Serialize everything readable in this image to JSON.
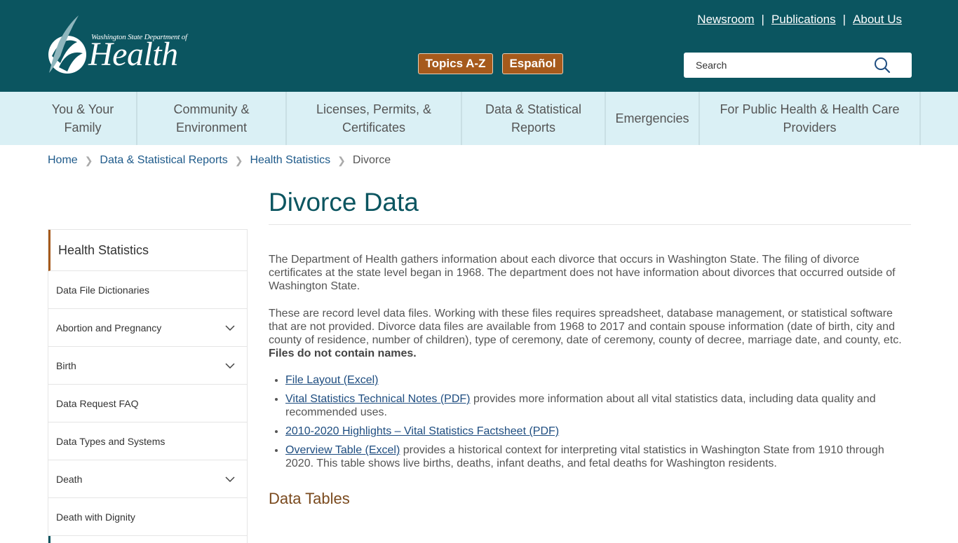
{
  "header": {
    "logo": {
      "department_line": "Washington State Department of",
      "name": "Health"
    },
    "utility_links": [
      "Newsroom",
      "Publications",
      "About Us"
    ],
    "separator": "|",
    "buttons": {
      "topics": "Topics A-Z",
      "espanol": "Español"
    },
    "search": {
      "placeholder": "Search",
      "icon": "search-icon"
    },
    "colors": {
      "header_bg": "#0b5560",
      "button_bg": "#a65a1c",
      "nav_bg": "#daf0f5"
    }
  },
  "nav": {
    "items": [
      "You & Your Family",
      "Community & Environment",
      "Licenses, Permits, & Certificates",
      "Data & Statistical Reports",
      "Emergencies",
      "For Public Health & Health Care Providers"
    ]
  },
  "breadcrumb": {
    "items": [
      "Home",
      "Data & Statistical Reports",
      "Health Statistics"
    ],
    "current": "Divorce"
  },
  "sidebar": {
    "title": "Health Statistics",
    "items": [
      {
        "label": "Data File Dictionaries",
        "expandable": false
      },
      {
        "label": "Abortion and Pregnancy",
        "expandable": true
      },
      {
        "label": "Birth",
        "expandable": true
      },
      {
        "label": "Data Request FAQ",
        "expandable": false
      },
      {
        "label": "Data Types and Systems",
        "expandable": false
      },
      {
        "label": "Death",
        "expandable": true
      },
      {
        "label": "Death with Dignity",
        "expandable": false
      }
    ]
  },
  "main": {
    "title": "Divorce Data",
    "paragraph1": "The Department of Health gathers information about each divorce that occurs in Washington State. The filing of divorce certificates at the state level began in 1968. The department does not have information about divorces that occurred outside of Washington State.",
    "paragraph2": "These are record level data files. Working with these files requires spreadsheet, database management, or statistical software that are not provided. Divorce data files are available from 1968 to 2017 and contain spouse information (date of birth, city and county of residence, number of children), type of ceremony, date of ceremony, county of decree, marriage date, and county, etc.",
    "paragraph2_bold": "Files do not contain names.",
    "links": [
      {
        "link": "File Layout (Excel)",
        "text": ""
      },
      {
        "link": "Vital Statistics Technical Notes (PDF)",
        "text": " provides more information about all vital statistics data, including data quality and recommended uses."
      },
      {
        "link": "2010-2020 Highlights – Vital Statistics Factsheet (PDF)",
        "text": ""
      },
      {
        "link": "Overview Table (Excel)",
        "text": " provides a historical context for interpreting vital statistics in Washington State from 1910 through 2020. This table shows live births, deaths, infant deaths, and fetal deaths for Washington residents."
      }
    ],
    "section_title": "Data Tables"
  }
}
